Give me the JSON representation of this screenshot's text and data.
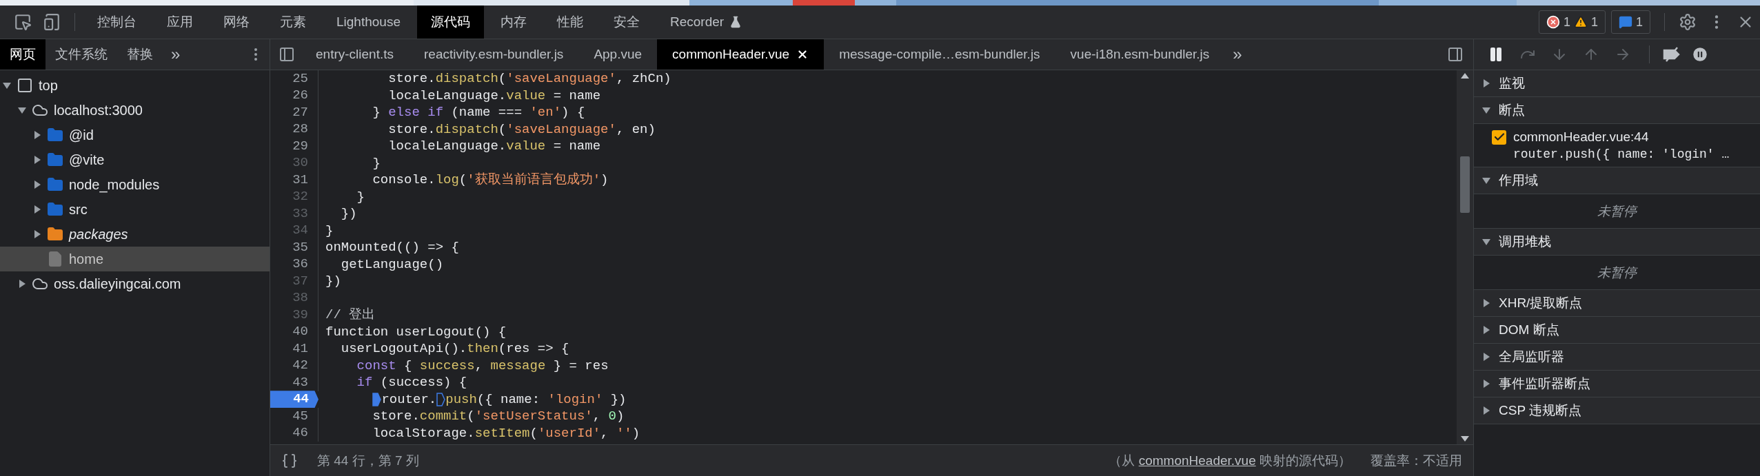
{
  "main_toolbar": {
    "tabs": [
      {
        "label": "控制台",
        "selected": false,
        "kind": "plain"
      },
      {
        "label": "应用",
        "selected": false,
        "kind": "plain"
      },
      {
        "label": "网络",
        "selected": false,
        "kind": "plain"
      },
      {
        "label": "元素",
        "selected": false,
        "kind": "plain"
      },
      {
        "label": "Lighthouse",
        "selected": false,
        "kind": "plain"
      },
      {
        "label": "源代码",
        "selected": true,
        "kind": "plain"
      },
      {
        "label": "内存",
        "selected": false,
        "kind": "plain"
      },
      {
        "label": "性能",
        "selected": false,
        "kind": "plain"
      },
      {
        "label": "安全",
        "selected": false,
        "kind": "plain"
      },
      {
        "label": "Recorder",
        "selected": false,
        "kind": "experimental"
      }
    ],
    "error_count": "1",
    "warning_count": "1",
    "message_count": "1"
  },
  "sidebar": {
    "tabs": [
      {
        "label": "网页",
        "selected": true
      },
      {
        "label": "文件系统",
        "selected": false
      },
      {
        "label": "替换",
        "selected": false
      }
    ],
    "more": "»",
    "tree": [
      {
        "label": "top",
        "kind": "frame",
        "expanded": true,
        "selected": false,
        "children": [
          {
            "label": "localhost:3000",
            "kind": "cloud",
            "expanded": true,
            "selected": false,
            "children": [
              {
                "label": "@id",
                "kind": "folder",
                "color": "#1a64c8",
                "italic": false,
                "expanded": false,
                "selected": false
              },
              {
                "label": "@vite",
                "kind": "folder",
                "color": "#1a64c8",
                "italic": false,
                "expanded": false,
                "selected": false
              },
              {
                "label": "node_modules",
                "kind": "folder",
                "color": "#1a64c8",
                "italic": false,
                "expanded": false,
                "selected": false
              },
              {
                "label": "src",
                "kind": "folder",
                "color": "#1a64c8",
                "italic": false,
                "expanded": false,
                "selected": false
              },
              {
                "label": "packages",
                "kind": "folder",
                "color": "#e8821e",
                "italic": true,
                "expanded": false,
                "selected": false
              },
              {
                "label": "home",
                "kind": "file",
                "selected": true
              }
            ]
          },
          {
            "label": "oss.dalieyingcai.com",
            "kind": "cloud",
            "expanded": false,
            "selected": false
          }
        ]
      }
    ]
  },
  "editor": {
    "tabs": [
      {
        "label": "entry-client.ts",
        "selected": false
      },
      {
        "label": "reactivity.esm-bundler.js",
        "selected": false
      },
      {
        "label": "App.vue",
        "selected": false
      },
      {
        "label": "commonHeader.vue",
        "selected": true
      },
      {
        "label": "message-compile…esm-bundler.js",
        "selected": false
      },
      {
        "label": "vue-i18n.esm-bundler.js",
        "selected": false
      }
    ],
    "more": "»",
    "lines": [
      {
        "number": "25",
        "dimmed": false,
        "breakpoint": false,
        "tokens": [
          {
            "kind": "plain",
            "text": "        store."
          },
          {
            "kind": "method",
            "text": "dispatch"
          },
          {
            "kind": "plain",
            "text": "("
          },
          {
            "kind": "string",
            "text": "'saveLanguage'"
          },
          {
            "kind": "plain",
            "text": ", zhCn)"
          }
        ]
      },
      {
        "number": "26",
        "dimmed": false,
        "breakpoint": false,
        "tokens": [
          {
            "kind": "plain",
            "text": "        localeLanguage."
          },
          {
            "kind": "method",
            "text": "value"
          },
          {
            "kind": "plain",
            "text": " = name"
          }
        ]
      },
      {
        "number": "27",
        "dimmed": false,
        "breakpoint": false,
        "tokens": [
          {
            "kind": "plain",
            "text": "      } "
          },
          {
            "kind": "keyword",
            "text": "else if"
          },
          {
            "kind": "plain",
            "text": " (name === "
          },
          {
            "kind": "string",
            "text": "'en'"
          },
          {
            "kind": "plain",
            "text": ") {"
          }
        ]
      },
      {
        "number": "28",
        "dimmed": false,
        "breakpoint": false,
        "tokens": [
          {
            "kind": "plain",
            "text": "        store."
          },
          {
            "kind": "method",
            "text": "dispatch"
          },
          {
            "kind": "plain",
            "text": "("
          },
          {
            "kind": "string",
            "text": "'saveLanguage'"
          },
          {
            "kind": "plain",
            "text": ", en)"
          }
        ]
      },
      {
        "number": "29",
        "dimmed": false,
        "breakpoint": false,
        "tokens": [
          {
            "kind": "plain",
            "text": "        localeLanguage."
          },
          {
            "kind": "method",
            "text": "value"
          },
          {
            "kind": "plain",
            "text": " = name"
          }
        ]
      },
      {
        "number": "30",
        "dimmed": true,
        "breakpoint": false,
        "tokens": [
          {
            "kind": "plain",
            "text": "      }"
          }
        ]
      },
      {
        "number": "31",
        "dimmed": false,
        "breakpoint": false,
        "tokens": [
          {
            "kind": "plain",
            "text": "      console."
          },
          {
            "kind": "method",
            "text": "log"
          },
          {
            "kind": "plain",
            "text": "("
          },
          {
            "kind": "string",
            "text": "'获取当前语言包成功'"
          },
          {
            "kind": "plain",
            "text": ")"
          }
        ]
      },
      {
        "number": "32",
        "dimmed": true,
        "breakpoint": false,
        "tokens": [
          {
            "kind": "plain",
            "text": "    }"
          }
        ]
      },
      {
        "number": "33",
        "dimmed": true,
        "breakpoint": false,
        "tokens": [
          {
            "kind": "plain",
            "text": "  })"
          }
        ]
      },
      {
        "number": "34",
        "dimmed": true,
        "breakpoint": false,
        "tokens": [
          {
            "kind": "plain",
            "text": "}"
          }
        ]
      },
      {
        "number": "35",
        "dimmed": false,
        "breakpoint": false,
        "tokens": [
          {
            "kind": "plain",
            "text": "onMounted(() => {"
          }
        ]
      },
      {
        "number": "36",
        "dimmed": false,
        "breakpoint": false,
        "tokens": [
          {
            "kind": "plain",
            "text": "  getLanguage()"
          }
        ]
      },
      {
        "number": "37",
        "dimmed": true,
        "breakpoint": false,
        "tokens": [
          {
            "kind": "plain",
            "text": "})"
          }
        ]
      },
      {
        "number": "38",
        "dimmed": true,
        "breakpoint": false
      },
      {
        "number": "39",
        "dimmed": true,
        "breakpoint": false,
        "tokens": [
          {
            "kind": "comment",
            "text": "// 登出"
          }
        ]
      },
      {
        "number": "40",
        "dimmed": false,
        "breakpoint": false,
        "tokens": [
          {
            "kind": "plain",
            "text": "function userLogout() {"
          }
        ]
      },
      {
        "number": "41",
        "dimmed": false,
        "breakpoint": false,
        "tokens": [
          {
            "kind": "plain",
            "text": "  userLogoutApi()."
          },
          {
            "kind": "method",
            "text": "then"
          },
          {
            "kind": "plain",
            "text": "(res => {"
          }
        ]
      },
      {
        "number": "42",
        "dimmed": false,
        "breakpoint": false,
        "tokens": [
          {
            "kind": "keyword",
            "text": "    const"
          },
          {
            "kind": "plain",
            "text": " { "
          },
          {
            "kind": "method",
            "text": "success"
          },
          {
            "kind": "plain",
            "text": ", "
          },
          {
            "kind": "method",
            "text": "message"
          },
          {
            "kind": "plain",
            "text": " } = res"
          }
        ]
      },
      {
        "number": "43",
        "dimmed": false,
        "breakpoint": false,
        "tokens": [
          {
            "kind": "keyword",
            "text": "    if"
          },
          {
            "kind": "plain",
            "text": " (success) {"
          }
        ]
      },
      {
        "number": "44",
        "dimmed": false,
        "breakpoint": true,
        "tokens": [
          {
            "kind": "plain",
            "text": "      router.",
            "marker": true
          },
          {
            "kind": "method",
            "text": "push",
            "marker": false
          },
          {
            "kind": "plain",
            "text": "({ name: "
          },
          {
            "kind": "string",
            "text": "'login'"
          },
          {
            "kind": "plain",
            "text": " })"
          }
        ]
      },
      {
        "number": "45",
        "dimmed": false,
        "breakpoint": false,
        "tokens": [
          {
            "kind": "plain",
            "text": "      store."
          },
          {
            "kind": "method",
            "text": "commit"
          },
          {
            "kind": "plain",
            "text": "("
          },
          {
            "kind": "string",
            "text": "'setUserStatus'"
          },
          {
            "kind": "plain",
            "text": ", "
          },
          {
            "kind": "number",
            "text": "0"
          },
          {
            "kind": "plain",
            "text": ")"
          }
        ]
      },
      {
        "number": "46",
        "dimmed": false,
        "breakpoint": false,
        "tokens": [
          {
            "kind": "plain",
            "text": "      localStorage."
          },
          {
            "kind": "method",
            "text": "setItem"
          },
          {
            "kind": "plain",
            "text": "("
          },
          {
            "kind": "string",
            "text": "'userId'"
          },
          {
            "kind": "plain",
            "text": ", "
          },
          {
            "kind": "string",
            "text": "''"
          },
          {
            "kind": "plain",
            "text": ")"
          }
        ]
      }
    ],
    "status": {
      "position": "第 44 行，第 7 列",
      "source_prefix": "（从 ",
      "source_link": "commonHeader.vue",
      "source_suffix": " 映射的源代码）",
      "coverage": "覆盖率：不适用"
    }
  },
  "debugger": {
    "sections": [
      {
        "title": "监视",
        "expanded": false
      },
      {
        "title": "断点",
        "expanded": true,
        "kind": "breakpoints",
        "items": [
          {
            "file": "commonHeader.vue:44",
            "code": "router.push({ name: 'login' …",
            "checked": true
          }
        ]
      },
      {
        "title": "作用域",
        "expanded": true,
        "kind": "message",
        "message": "未暂停"
      },
      {
        "title": "调用堆栈",
        "expanded": true,
        "kind": "message",
        "message": "未暂停"
      },
      {
        "title": "XHR/提取断点",
        "expanded": false
      },
      {
        "title": "DOM 断点",
        "expanded": false
      },
      {
        "title": "全局监听器",
        "expanded": false
      },
      {
        "title": "事件监听器断点",
        "expanded": false
      },
      {
        "title": "CSP 违规断点",
        "expanded": false
      }
    ]
  }
}
